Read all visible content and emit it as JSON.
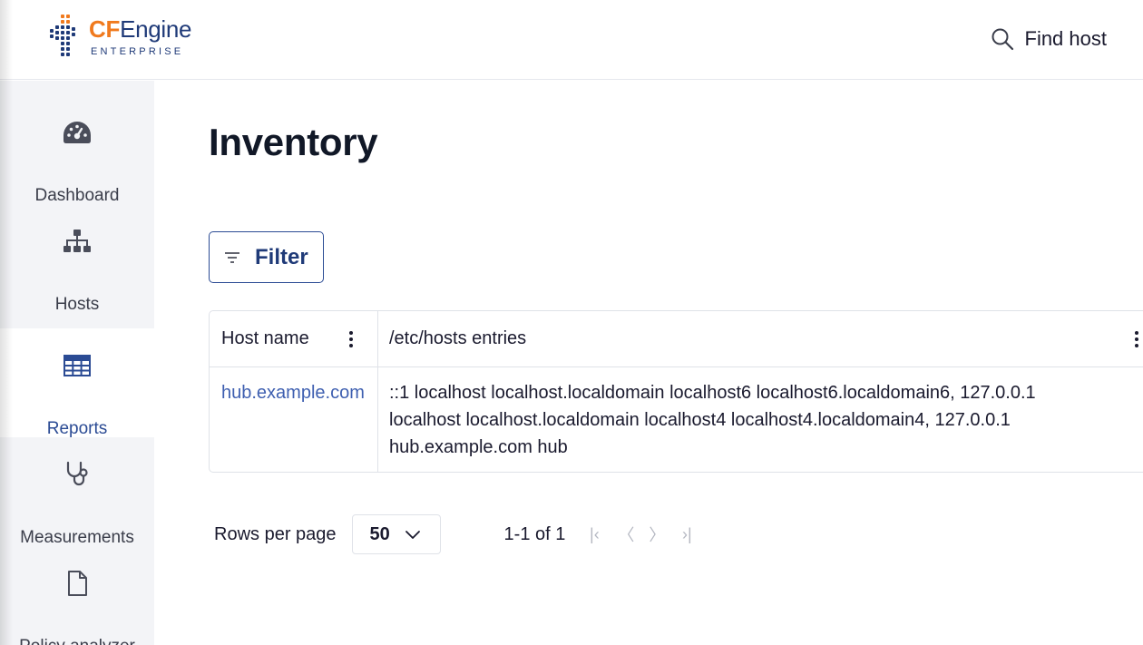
{
  "brand": {
    "name_prefix": "CF",
    "name_suffix": "Engine",
    "subtitle": "ENTERPRISE",
    "accent_color": "#f07a1e",
    "primary_color": "#1f3a78"
  },
  "header": {
    "find_host_label": "Find host",
    "find_host_icon": "search-icon"
  },
  "sidebar": {
    "items": [
      {
        "label": "Dashboard",
        "icon": "dashboard-gauge-icon",
        "active": false
      },
      {
        "label": "Hosts",
        "icon": "hierarchy-icon",
        "active": false
      },
      {
        "label": "Reports",
        "icon": "table-icon",
        "active": true
      },
      {
        "label": "Measurements",
        "icon": "stethoscope-icon",
        "active": false
      },
      {
        "label": "Policy analyzer",
        "icon": "file-icon",
        "active": false
      }
    ]
  },
  "main": {
    "title": "Inventory",
    "filter_label": "Filter",
    "table": {
      "columns": [
        "Host name",
        "/etc/hosts entries"
      ],
      "rows": [
        {
          "host_name": "hub.example.com",
          "etc_hosts": "::1 localhost localhost.localdomain localhost6 localhost6.localdomain6, 127.0.0.1 localhost localhost.localdomain localhost4 localhost4.localdomain4, 127.0.0.1 hub.example.com hub"
        }
      ]
    },
    "pagination": {
      "rows_per_page_label": "Rows per page",
      "rows_per_page_value": "50",
      "range_text": "1-1 of 1",
      "first_symbol": "|‹",
      "prev_symbol": "〈",
      "next_symbol": "〉",
      "last_symbol": "›|"
    }
  }
}
